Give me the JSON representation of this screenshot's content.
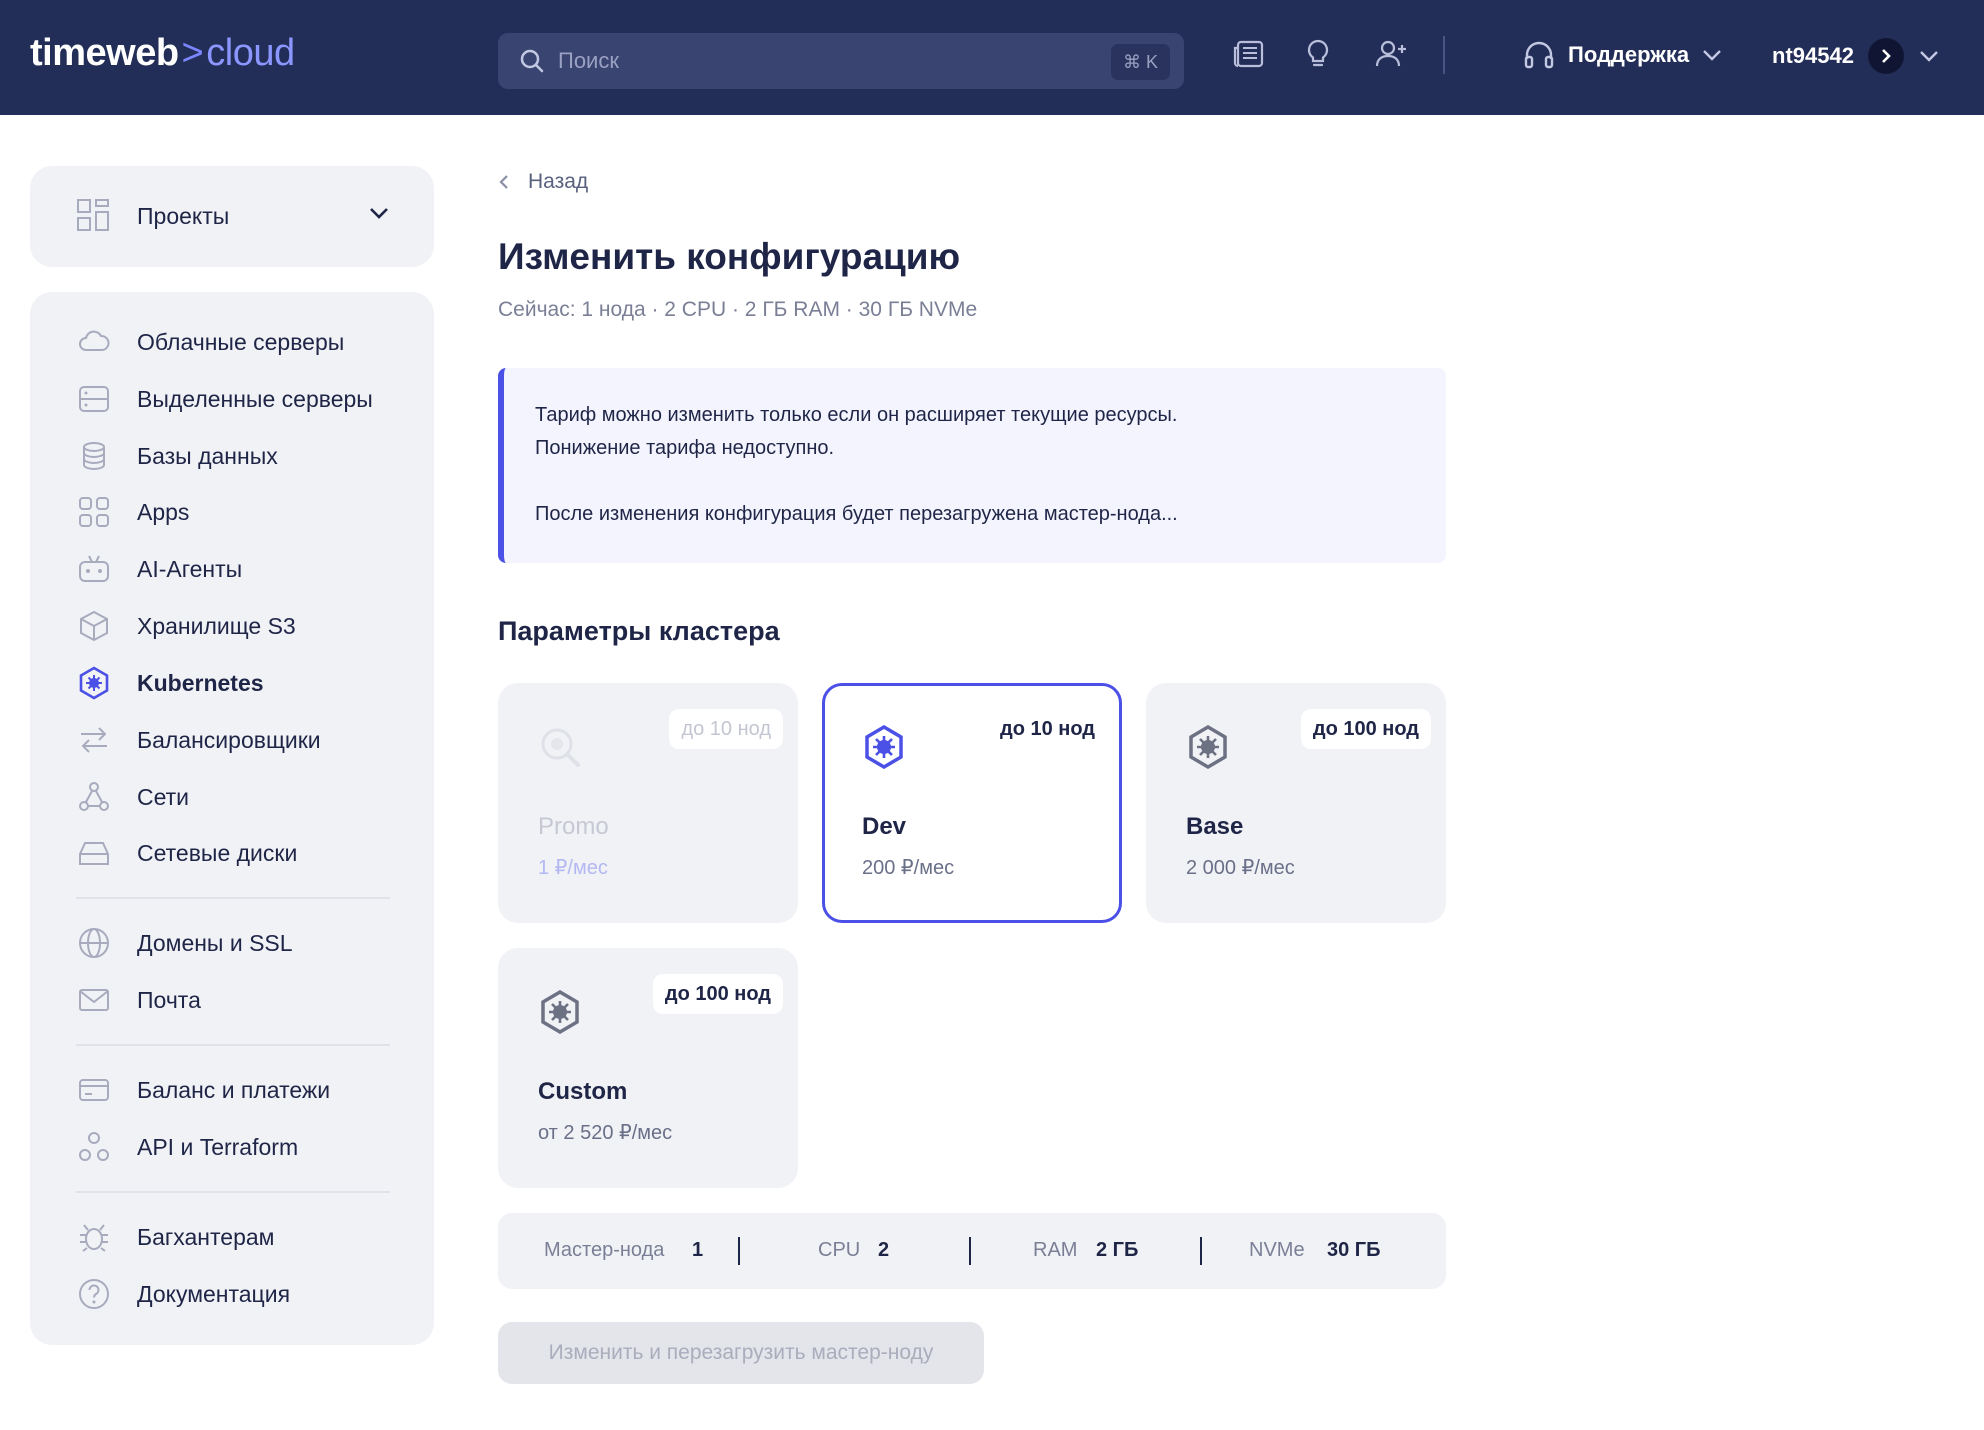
{
  "header": {
    "logo_main": "timeweb",
    "logo_chevron": ">",
    "logo_cloud": "cloud",
    "search_placeholder": "Поиск",
    "search_shortcut": "⌘ K",
    "support_label": "Поддержка",
    "username": "nt94542",
    "colors": {
      "bg": "#232e58",
      "accent": "#8b96ff"
    }
  },
  "sidebar": {
    "projects_label": "Проекты",
    "items": [
      {
        "label": "Облачные серверы",
        "icon": "cloud-icon"
      },
      {
        "label": "Выделенные серверы",
        "icon": "server-icon"
      },
      {
        "label": "Базы данных",
        "icon": "database-icon"
      },
      {
        "label": "Apps",
        "icon": "apps-icon"
      },
      {
        "label": "AI-Агенты",
        "icon": "robot-icon"
      },
      {
        "label": "Хранилище S3",
        "icon": "cube-icon"
      },
      {
        "label": "Kubernetes",
        "icon": "kubernetes-icon",
        "active": true
      },
      {
        "label": "Балансировщики",
        "icon": "arrows-icon"
      },
      {
        "label": "Сети",
        "icon": "network-icon"
      },
      {
        "label": "Сетевые диски",
        "icon": "disk-icon"
      },
      {
        "label": "Домены и SSL",
        "icon": "globe-icon"
      },
      {
        "label": "Почта",
        "icon": "mail-icon"
      },
      {
        "label": "Баланс и платежи",
        "icon": "card-icon"
      },
      {
        "label": "API и Terraform",
        "icon": "api-icon"
      },
      {
        "label": "Багхантерам",
        "icon": "bug-icon"
      },
      {
        "label": "Документация",
        "icon": "help-icon"
      }
    ]
  },
  "main": {
    "back_label": "Назад",
    "title": "Изменить конфигурацию",
    "current": "Сейчас: 1 нода · 2 CPU · 2 ГБ RAM · 30 ГБ NVMe",
    "info_line1": "Тариф можно изменить только если он расширяет текущие ресурсы.",
    "info_line2": "Понижение тарифа недоступно.",
    "info_line3": "После изменения конфигурация будет перезагружена мастер-нода...",
    "section_title": "Параметры кластера",
    "plans": [
      {
        "name": "Promo",
        "price": "1 ₽/мес",
        "badge": "до 10 нод",
        "state": "disabled"
      },
      {
        "name": "Dev",
        "price": "200 ₽/мес",
        "badge": "до 10 нод",
        "state": "selected"
      },
      {
        "name": "Base",
        "price": "2 000 ₽/мес",
        "badge": "до 100 нод",
        "state": "available"
      },
      {
        "name": "Custom",
        "price": "от 2 520 ₽/мес",
        "badge": "до 100 нод",
        "state": "available"
      }
    ],
    "summary": {
      "master_label": "Мастер-нода",
      "master_value": "1",
      "cpu_label": "CPU",
      "cpu_value": "2",
      "ram_label": "RAM",
      "ram_value": "2 ГБ",
      "nvme_label": "NVMe",
      "nvme_value": "30 ГБ"
    },
    "submit_label": "Изменить и перезагрузить мастер-ноду",
    "colors": {
      "accent": "#4b50e6",
      "card_bg": "#f1f2f6"
    }
  }
}
